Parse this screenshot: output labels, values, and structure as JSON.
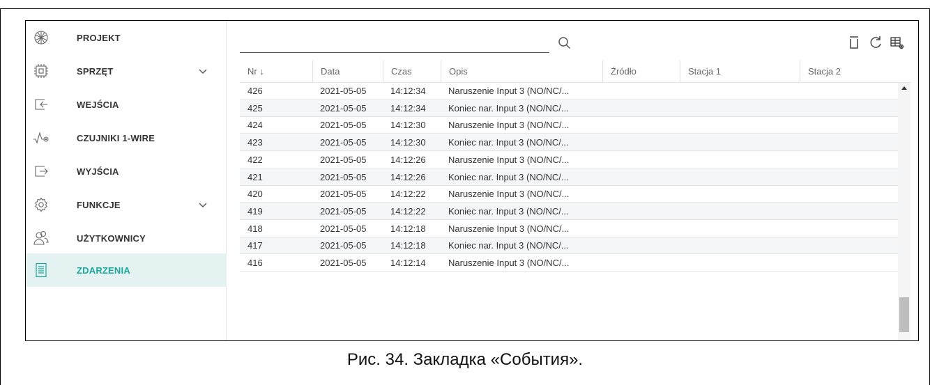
{
  "sidebar": {
    "items": [
      {
        "label": "PROJEKT",
        "icon": "project-icon",
        "chevron": false,
        "active": false
      },
      {
        "label": "SPRZĘT",
        "icon": "hardware-icon",
        "chevron": true,
        "active": false
      },
      {
        "label": "WEJŚCIA",
        "icon": "input-icon",
        "chevron": false,
        "active": false
      },
      {
        "label": "CZUJNIKI 1-WIRE",
        "icon": "sensor-icon",
        "chevron": false,
        "active": false
      },
      {
        "label": "WYJŚCIA",
        "icon": "output-icon",
        "chevron": false,
        "active": false
      },
      {
        "label": "FUNKCJE",
        "icon": "gear-icon",
        "chevron": true,
        "active": false
      },
      {
        "label": "UŻYTKOWNICY",
        "icon": "users-icon",
        "chevron": false,
        "active": false
      },
      {
        "label": "ZDARZENIA",
        "icon": "events-list-icon",
        "chevron": false,
        "active": true
      }
    ]
  },
  "toolbar": {
    "search_value": "",
    "icons": [
      "search-icon",
      "trash-icon",
      "refresh-icon",
      "table-settings-icon"
    ]
  },
  "table": {
    "columns": [
      "Nr ↓",
      "Data",
      "Czas",
      "Opis",
      "Źródło",
      "Stacja 1",
      "Stacja 2"
    ],
    "rows": [
      [
        "426",
        "2021-05-05",
        "14:12:34",
        "Naruszenie Input 3 (NO/NC/...",
        "",
        "",
        ""
      ],
      [
        "425",
        "2021-05-05",
        "14:12:34",
        "Koniec nar. Input 3 (NO/NC/...",
        "",
        "",
        ""
      ],
      [
        "424",
        "2021-05-05",
        "14:12:30",
        "Naruszenie Input 3 (NO/NC/...",
        "",
        "",
        ""
      ],
      [
        "423",
        "2021-05-05",
        "14:12:30",
        "Koniec nar. Input 3 (NO/NC/...",
        "",
        "",
        ""
      ],
      [
        "422",
        "2021-05-05",
        "14:12:26",
        "Naruszenie Input 3 (NO/NC/...",
        "",
        "",
        ""
      ],
      [
        "421",
        "2021-05-05",
        "14:12:26",
        "Koniec nar. Input 3 (NO/NC/...",
        "",
        "",
        ""
      ],
      [
        "420",
        "2021-05-05",
        "14:12:22",
        "Naruszenie Input 3 (NO/NC/...",
        "",
        "",
        ""
      ],
      [
        "419",
        "2021-05-05",
        "14:12:22",
        "Koniec nar. Input 3 (NO/NC/...",
        "",
        "",
        ""
      ],
      [
        "418",
        "2021-05-05",
        "14:12:18",
        "Naruszenie Input 3 (NO/NC/...",
        "",
        "",
        ""
      ],
      [
        "417",
        "2021-05-05",
        "14:12:18",
        "Koniec nar. Input 3 (NO/NC/...",
        "",
        "",
        ""
      ],
      [
        "416",
        "2021-05-05",
        "14:12:14",
        "Naruszenie Input 3 (NO/NC/...",
        "",
        "",
        ""
      ]
    ]
  },
  "colors": {
    "accent": "#1aa69e",
    "active_bg": "#e4f2f1",
    "alt_row": "#f5f6f7"
  },
  "caption": "Рис. 34. Закладка «События»."
}
